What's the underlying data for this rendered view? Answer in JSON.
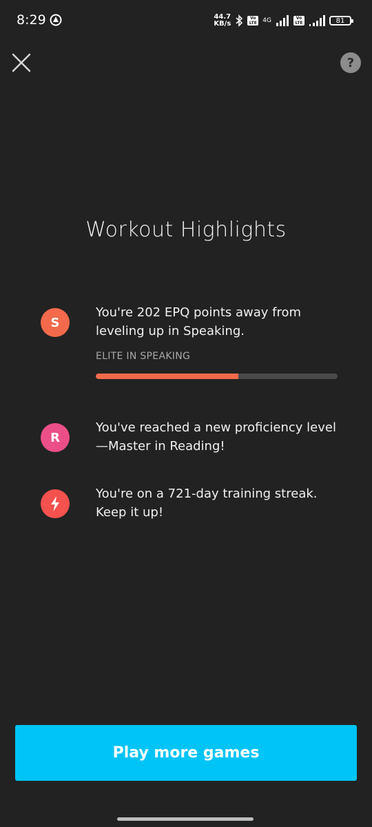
{
  "status_bar": {
    "time": "8:29",
    "net_speed_value": "44.7",
    "net_speed_unit": "KB/s",
    "volte_1": "Vo LTE",
    "net_type": "4G",
    "volte_2": "Vo LTE",
    "battery": "81"
  },
  "header": {
    "close_icon": "close-icon",
    "help_label": "?"
  },
  "title": "Workout Highlights",
  "highlights": [
    {
      "icon_letter": "S",
      "icon_color": "#f26a4b",
      "text_line1": "You're 202 EPQ points away from",
      "text_line2": "leveling up in Speaking.",
      "sublabel": "ELITE IN SPEAKING",
      "progress_percent": 59
    },
    {
      "icon_letter": "R",
      "icon_color": "#ec4f87",
      "text_line1": "You've reached a new proficiency level",
      "text_line2": "—Master in Reading!"
    },
    {
      "icon_name": "lightning-bolt-icon",
      "icon_color": "#f5514e",
      "text_line1": "You're on a 721-day training streak.",
      "text_line2": "Keep it up!"
    }
  ],
  "primary_button": {
    "label": "Play more games",
    "color": "#00c4f5"
  }
}
